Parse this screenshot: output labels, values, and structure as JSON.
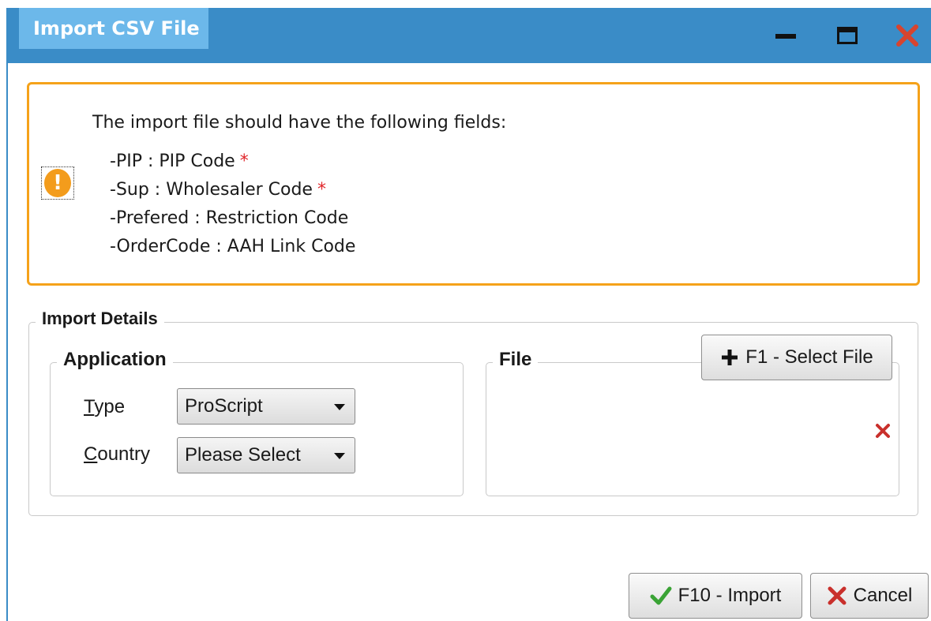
{
  "window": {
    "title": "Import CSV File",
    "controls": {
      "minimize_icon": "minimize-icon",
      "maximize_icon": "maximize-icon",
      "close_icon": "close-icon"
    },
    "colors": {
      "titlebar": "#3a8cc7",
      "title_tab": "#6cb8ea",
      "close": "#d7442f"
    }
  },
  "notice": {
    "icon": "warning-icon",
    "heading": "The import file should have the following fields:",
    "lines": [
      {
        "text": "-PIP : PIP Code",
        "required_mark": "*"
      },
      {
        "text": "-Sup : Wholesaler Code",
        "required_mark": "*"
      },
      {
        "text": "-Prefered : Restriction Code",
        "required_mark": ""
      },
      {
        "text": "-OrderCode : AAH Link Code",
        "required_mark": ""
      }
    ],
    "border_color": "#f5a21a"
  },
  "import_details": {
    "legend": "Import Details",
    "application": {
      "legend": "Application",
      "type_label_first": "T",
      "type_label_rest": "ype",
      "type_value": "ProScript",
      "country_label_first": "C",
      "country_label_rest": "ountry",
      "country_value": "Please Select"
    },
    "file": {
      "legend": "File",
      "select_button_label": "F1 - Select File",
      "select_button_icon": "plus-icon",
      "clear_icon": "clear-icon"
    }
  },
  "footer": {
    "import_label": "F10 - Import",
    "import_icon": "check-icon",
    "cancel_label": "Cancel",
    "cancel_icon": "cancel-x-icon"
  }
}
